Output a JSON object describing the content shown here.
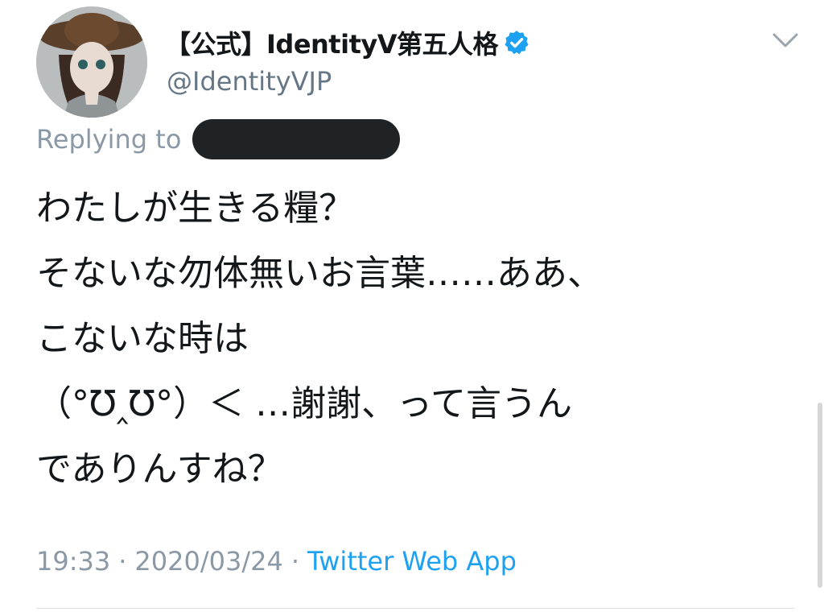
{
  "tweet": {
    "display_name": "【公式】IdentityV第五人格",
    "handle": "@IdentityVJP",
    "verified": true,
    "reply_label": "Replying to",
    "text_lines": [
      "わたしが生きる糧？",
      "そないな勿体無いお言葉……ああ、",
      "こないな時は",
      "（°℧‸℧°）＜ …謝謝、って言うん",
      "でありんすね？"
    ],
    "time": "19:33",
    "separator": "·",
    "date": "2020/03/24",
    "source": "Twitter Web App"
  },
  "icons": {
    "verified": "verified-badge-icon",
    "menu": "chevron-down-icon",
    "avatar": "avatar-image"
  },
  "colors": {
    "name": "#14171a",
    "secondary": "#657786",
    "link": "#1da1f2",
    "verified": "#1da1f2",
    "redaction": "#202326"
  }
}
